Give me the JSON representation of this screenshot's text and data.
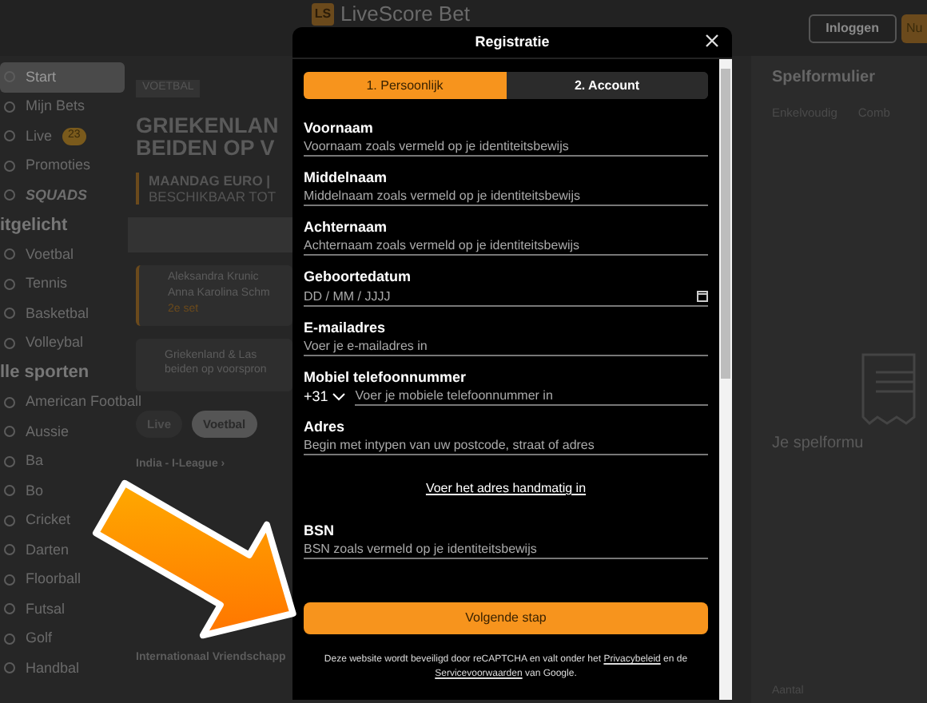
{
  "header": {
    "logo_mark": "LS",
    "logo_text": "LiveScore Bet",
    "login": "Inloggen",
    "signup": "Nu"
  },
  "sidebar": {
    "items": [
      {
        "kind": "link",
        "label": "Start",
        "selected": true
      },
      {
        "kind": "link",
        "label": "Mijn Bets",
        "selected": false
      },
      {
        "kind": "link",
        "label": "Live",
        "badge": "23",
        "selected": false
      },
      {
        "kind": "link",
        "label": "Promoties",
        "selected": false
      },
      {
        "kind": "brand",
        "label": "SQUADS",
        "selected": false
      },
      {
        "kind": "heading",
        "label": "itgelicht"
      },
      {
        "kind": "link",
        "label": "Voetbal",
        "selected": false
      },
      {
        "kind": "link",
        "label": "Tennis",
        "selected": false
      },
      {
        "kind": "link",
        "label": "Basketbal",
        "selected": false
      },
      {
        "kind": "link",
        "label": "Volleybal",
        "selected": false
      },
      {
        "kind": "heading",
        "label": "lle sporten"
      },
      {
        "kind": "link",
        "label": "American Football",
        "selected": false
      },
      {
        "kind": "link",
        "label": "Aussie",
        "selected": false
      },
      {
        "kind": "link",
        "label": "Ba",
        "selected": false
      },
      {
        "kind": "link",
        "label": "Bo",
        "selected": false
      },
      {
        "kind": "link",
        "label": "Cricket",
        "selected": false
      },
      {
        "kind": "link",
        "label": "Darten",
        "selected": false
      },
      {
        "kind": "link",
        "label": "Floorball",
        "selected": false
      },
      {
        "kind": "link",
        "label": "Futsal",
        "selected": false
      },
      {
        "kind": "link",
        "label": "Golf",
        "selected": false
      },
      {
        "kind": "link",
        "label": "Handbal",
        "selected": false
      }
    ]
  },
  "main": {
    "tag": "VOETBAL",
    "headline": [
      "GRIEKENLAN",
      "BEIDEN OP V"
    ],
    "promo": [
      "MAANDAG EURO |",
      "BESCHIKBAAR TOT"
    ],
    "match": {
      "players": [
        "Aleksandra Krunic",
        "Anna Karolina Schm"
      ],
      "status": "2e set"
    },
    "promo_card": [
      "Griekenland & Las",
      "beiden op voorspron"
    ],
    "pills": [
      {
        "label": "Live",
        "selected": false
      },
      {
        "label": "Voetbal",
        "selected": true
      }
    ],
    "leagues": [
      "India - I-League ›",
      "Internationaal Vriendschapp"
    ]
  },
  "betslip": {
    "title": "Spelformulier",
    "tabs": [
      "Enkelvoudig",
      "Comb"
    ],
    "empty": "Je spelformu",
    "footer": "Aantal"
  },
  "modal": {
    "title": "Registratie",
    "steps": [
      {
        "label": "1. Persoonlijk",
        "selected": true
      },
      {
        "label": "2. Account",
        "selected": false
      }
    ],
    "fields": [
      {
        "kind": "text",
        "label": "Voornaam",
        "placeholder": "Voornaam zoals vermeld op je identiteitsbewijs"
      },
      {
        "kind": "text",
        "label": "Middelnaam",
        "placeholder": "Middelnaam zoals vermeld op je identiteitsbewijs"
      },
      {
        "kind": "text",
        "label": "Achternaam",
        "placeholder": "Achternaam zoals vermeld op je identiteitsbewijs"
      },
      {
        "kind": "date",
        "label": "Geboortedatum",
        "placeholder": "DD / MM / JJJJ"
      },
      {
        "kind": "text",
        "label": "E-mailadres",
        "placeholder": "Voer je e-mailadres in"
      },
      {
        "kind": "phone",
        "label": "Mobiel telefoonnummer",
        "prefix": "+31",
        "placeholder": "Voer je mobiele telefoonnummer in"
      },
      {
        "kind": "text",
        "label": "Adres",
        "placeholder": "Begin met intypen van uw postcode, straat of adres"
      },
      {
        "kind": "link",
        "label": "Voer het adres handmatig in"
      },
      {
        "kind": "text",
        "label": "BSN",
        "placeholder": "BSN zoals vermeld op je identiteitsbewijs"
      }
    ],
    "submit": "Volgende stap",
    "notice": {
      "before": "Deze website wordt beveiligd door reCAPTCHA en valt onder het",
      "link1": "Privacybeleid",
      "middle": "en de",
      "link2": "Servicevoorwaarden",
      "after": "van Google."
    }
  }
}
